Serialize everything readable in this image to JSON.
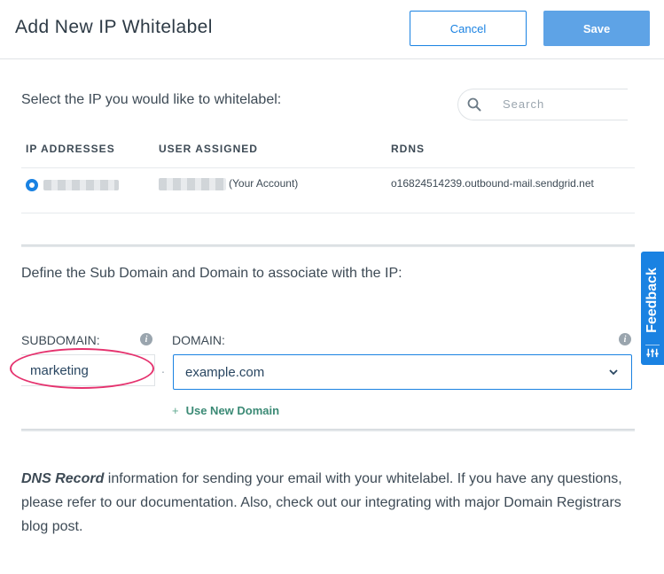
{
  "header": {
    "title": "Add New IP Whitelabel",
    "cancel_label": "Cancel",
    "save_label": "Save"
  },
  "ip_section": {
    "prompt": "Select the IP you would like to whitelabel:",
    "search_placeholder": "Search",
    "columns": [
      "IP ADDRESSES",
      "USER ASSIGNED",
      "RDNS"
    ],
    "rows": [
      {
        "selected": true,
        "user_suffix": "(Your Account)",
        "rdns": "o16824514239.outbound-mail.sendgrid.net"
      }
    ]
  },
  "domain_section": {
    "prompt": "Define the Sub Domain and Domain to associate with the IP:",
    "subdomain_label": "SUBDOMAIN:",
    "domain_label": "DOMAIN:",
    "info_glyph": "i",
    "subdomain_value": "marketing",
    "separator": ".",
    "domain_value": "example.com",
    "use_new_domain_plus": "+",
    "use_new_domain_label": "Use New Domain"
  },
  "dns_info": {
    "strong": "DNS Record",
    "text": " information for sending your email with your whitelabel. If you have any questions, please refer to our documentation. Also, check out our integrating with major Domain Registrars blog post."
  },
  "feedback": {
    "label": "Feedback"
  },
  "colors": {
    "primary": "#1a82e2",
    "save_button": "#5ea3e6",
    "highlight": "#e5326e",
    "link_green": "#3b8a75"
  },
  "icons": [
    "search-icon",
    "info-icon",
    "chevron-down-icon",
    "feedback-sliders-icon"
  ]
}
